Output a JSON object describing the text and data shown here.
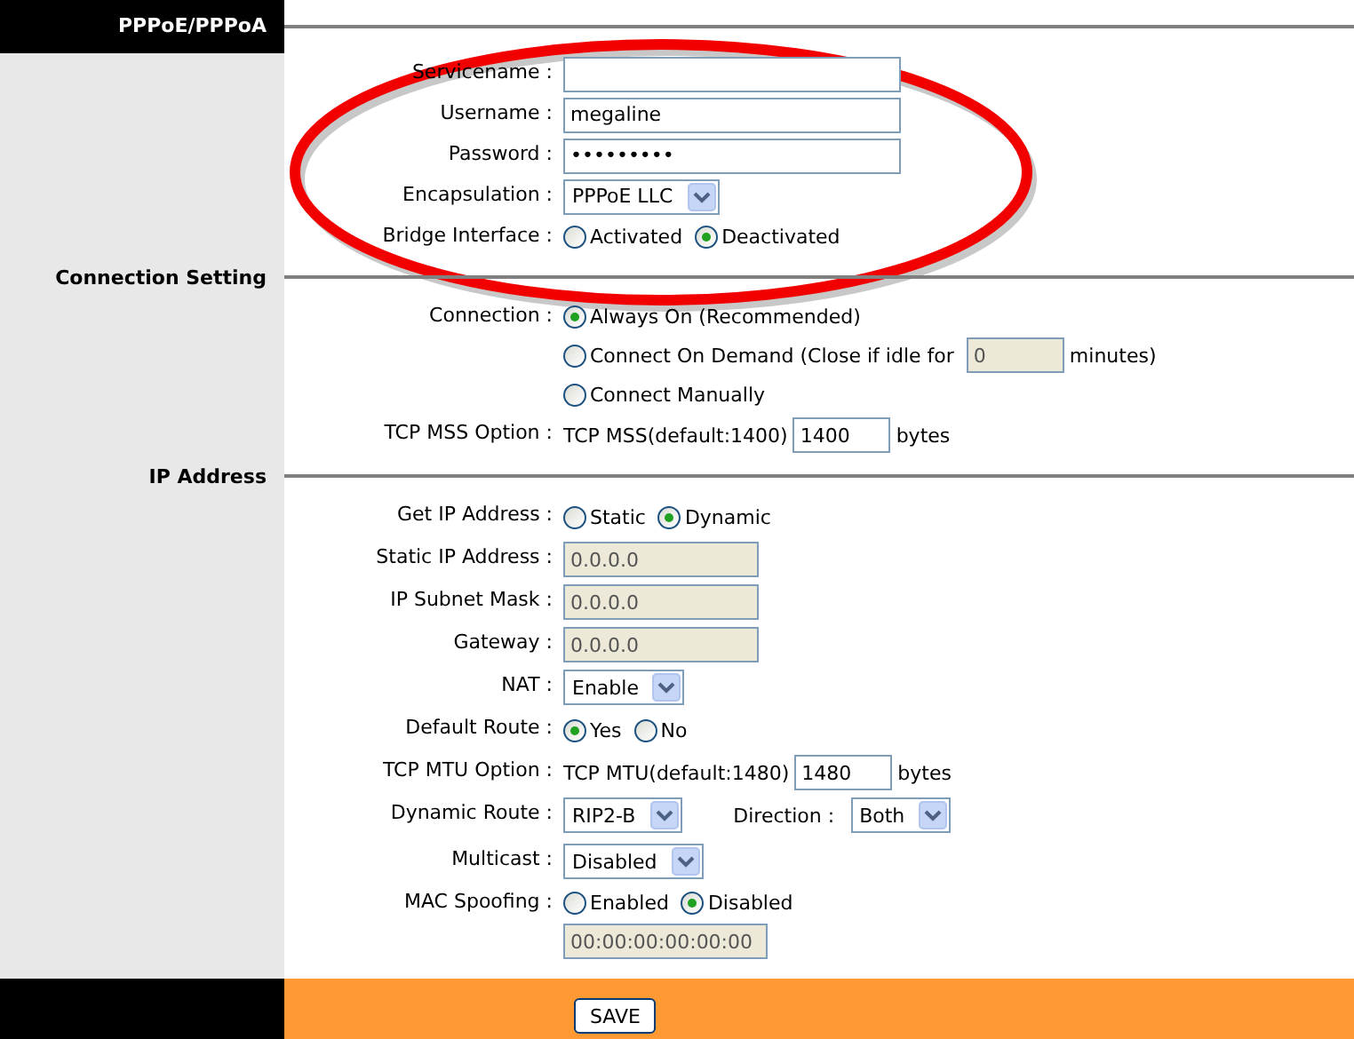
{
  "sections": [
    {
      "kind": "main",
      "title": "PPPoE/PPPoA",
      "rows": [
        {
          "kind": "input",
          "label": "Servicename :",
          "disabled": false
        },
        {
          "kind": "input",
          "label": "Username :",
          "value": "megaline",
          "disabled": false
        },
        {
          "kind": "input",
          "label": "Password :",
          "value": "•••••••••",
          "disabled": false
        },
        {
          "kind": "select",
          "label": "Encapsulation :",
          "value": "PPPoE LLC"
        },
        {
          "kind": "radios",
          "label": "Bridge Interface :",
          "options": [
            {
              "label": "Activated",
              "selected": false
            },
            {
              "label": "Deactivated",
              "selected": true
            }
          ]
        }
      ]
    },
    {
      "kind": "sub",
      "title": "Connection Setting",
      "rows": [
        {
          "kind": "radio_list",
          "label": "Connection :",
          "options": [
            {
              "label": "Always On (Recommended)",
              "selected": true
            },
            {
              "label": "Connect On Demand (Close if idle for",
              "selected": false,
              "field": {
                "value": "0",
                "disabled": true
              },
              "suffix": "minutes)"
            },
            {
              "label": "Connect Manually",
              "selected": false
            }
          ]
        },
        {
          "kind": "number",
          "label": "TCP MSS Option :",
          "prefix": "TCP MSS(default:1400)",
          "value": "1400",
          "suffix": "bytes"
        }
      ]
    },
    {
      "kind": "sub",
      "title": "IP Address",
      "rows": [
        {
          "kind": "radios",
          "label": "Get IP Address :",
          "options": [
            {
              "label": "Static",
              "selected": false
            },
            {
              "label": "Dynamic",
              "selected": true
            }
          ]
        },
        {
          "kind": "input",
          "label": "Static IP Address :",
          "value": "0.0.0.0",
          "disabled": true
        },
        {
          "kind": "input",
          "label": "IP Subnet Mask :",
          "value": "0.0.0.0",
          "disabled": true
        },
        {
          "kind": "input",
          "label": "Gateway :",
          "value": "0.0.0.0",
          "disabled": true
        },
        {
          "kind": "select",
          "label": "NAT :",
          "value": "Enable"
        },
        {
          "kind": "radios",
          "label": "Default Route :",
          "options": [
            {
              "label": "Yes",
              "selected": true
            },
            {
              "label": "No",
              "selected": false
            }
          ]
        },
        {
          "kind": "number",
          "label": "TCP MTU Option :",
          "prefix": "TCP MTU(default:1480)",
          "value": "1480",
          "suffix": "bytes"
        },
        {
          "kind": "select_pair",
          "label": "Dynamic Route :",
          "value": "RIP2-B",
          "label2": "Direction :",
          "value2": "Both"
        },
        {
          "kind": "select",
          "label": "Multicast :",
          "value": "Disabled"
        },
        {
          "kind": "radios",
          "label": "MAC Spoofing :",
          "options": [
            {
              "label": "Enabled",
              "selected": false
            },
            {
              "label": "Disabled",
              "selected": true
            }
          ],
          "field": {
            "value": "00:00:00:00:00:00",
            "disabled": true
          }
        }
      ]
    }
  ],
  "footer": {
    "save": "SAVE"
  }
}
